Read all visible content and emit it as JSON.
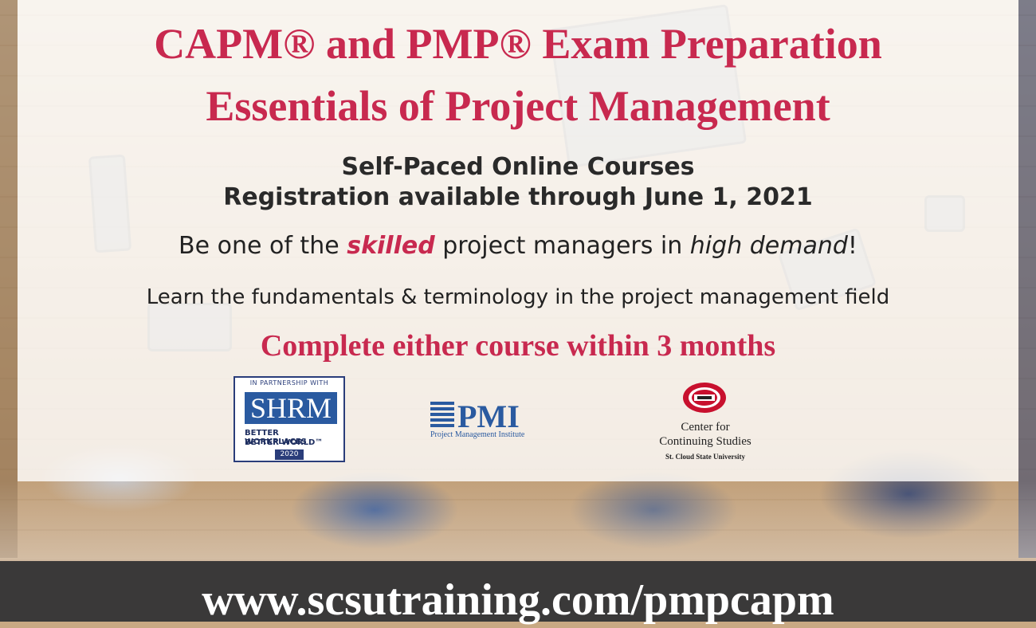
{
  "headline": {
    "line1": "CAPM® and PMP® Exam Preparation",
    "line2": "Essentials of Project Management"
  },
  "subheading": {
    "line1": "Self-Paced Online Courses",
    "line2": "Registration available through June 1, 2021"
  },
  "tagline": {
    "before": "Be one of the ",
    "skilled": "skilled",
    "middle": " project managers in ",
    "demand": "high demand",
    "after": "!"
  },
  "description": "Learn the fundamentals & terminology in the project management field",
  "cta": "Complete either course within 3 months",
  "logos": {
    "shrm": {
      "partnership": "IN PARTNERSHIP WITH",
      "wordmark": "SHRM",
      "tag1": "BETTER WORKPLACES",
      "tag2": "BETTER WORLD™",
      "year": "2020"
    },
    "pmi": {
      "wordmark": "PMI",
      "name": "Project Management Institute"
    },
    "scsu": {
      "line1": "Center for",
      "line2": "Continuing Studies",
      "line3": "St. Cloud State University"
    }
  },
  "footer": {
    "url": "www.scsutraining.com/pmpcapm"
  },
  "colors": {
    "accent": "#c8294f",
    "footer_bg": "#3a3939",
    "text": "#2a2a2a"
  }
}
